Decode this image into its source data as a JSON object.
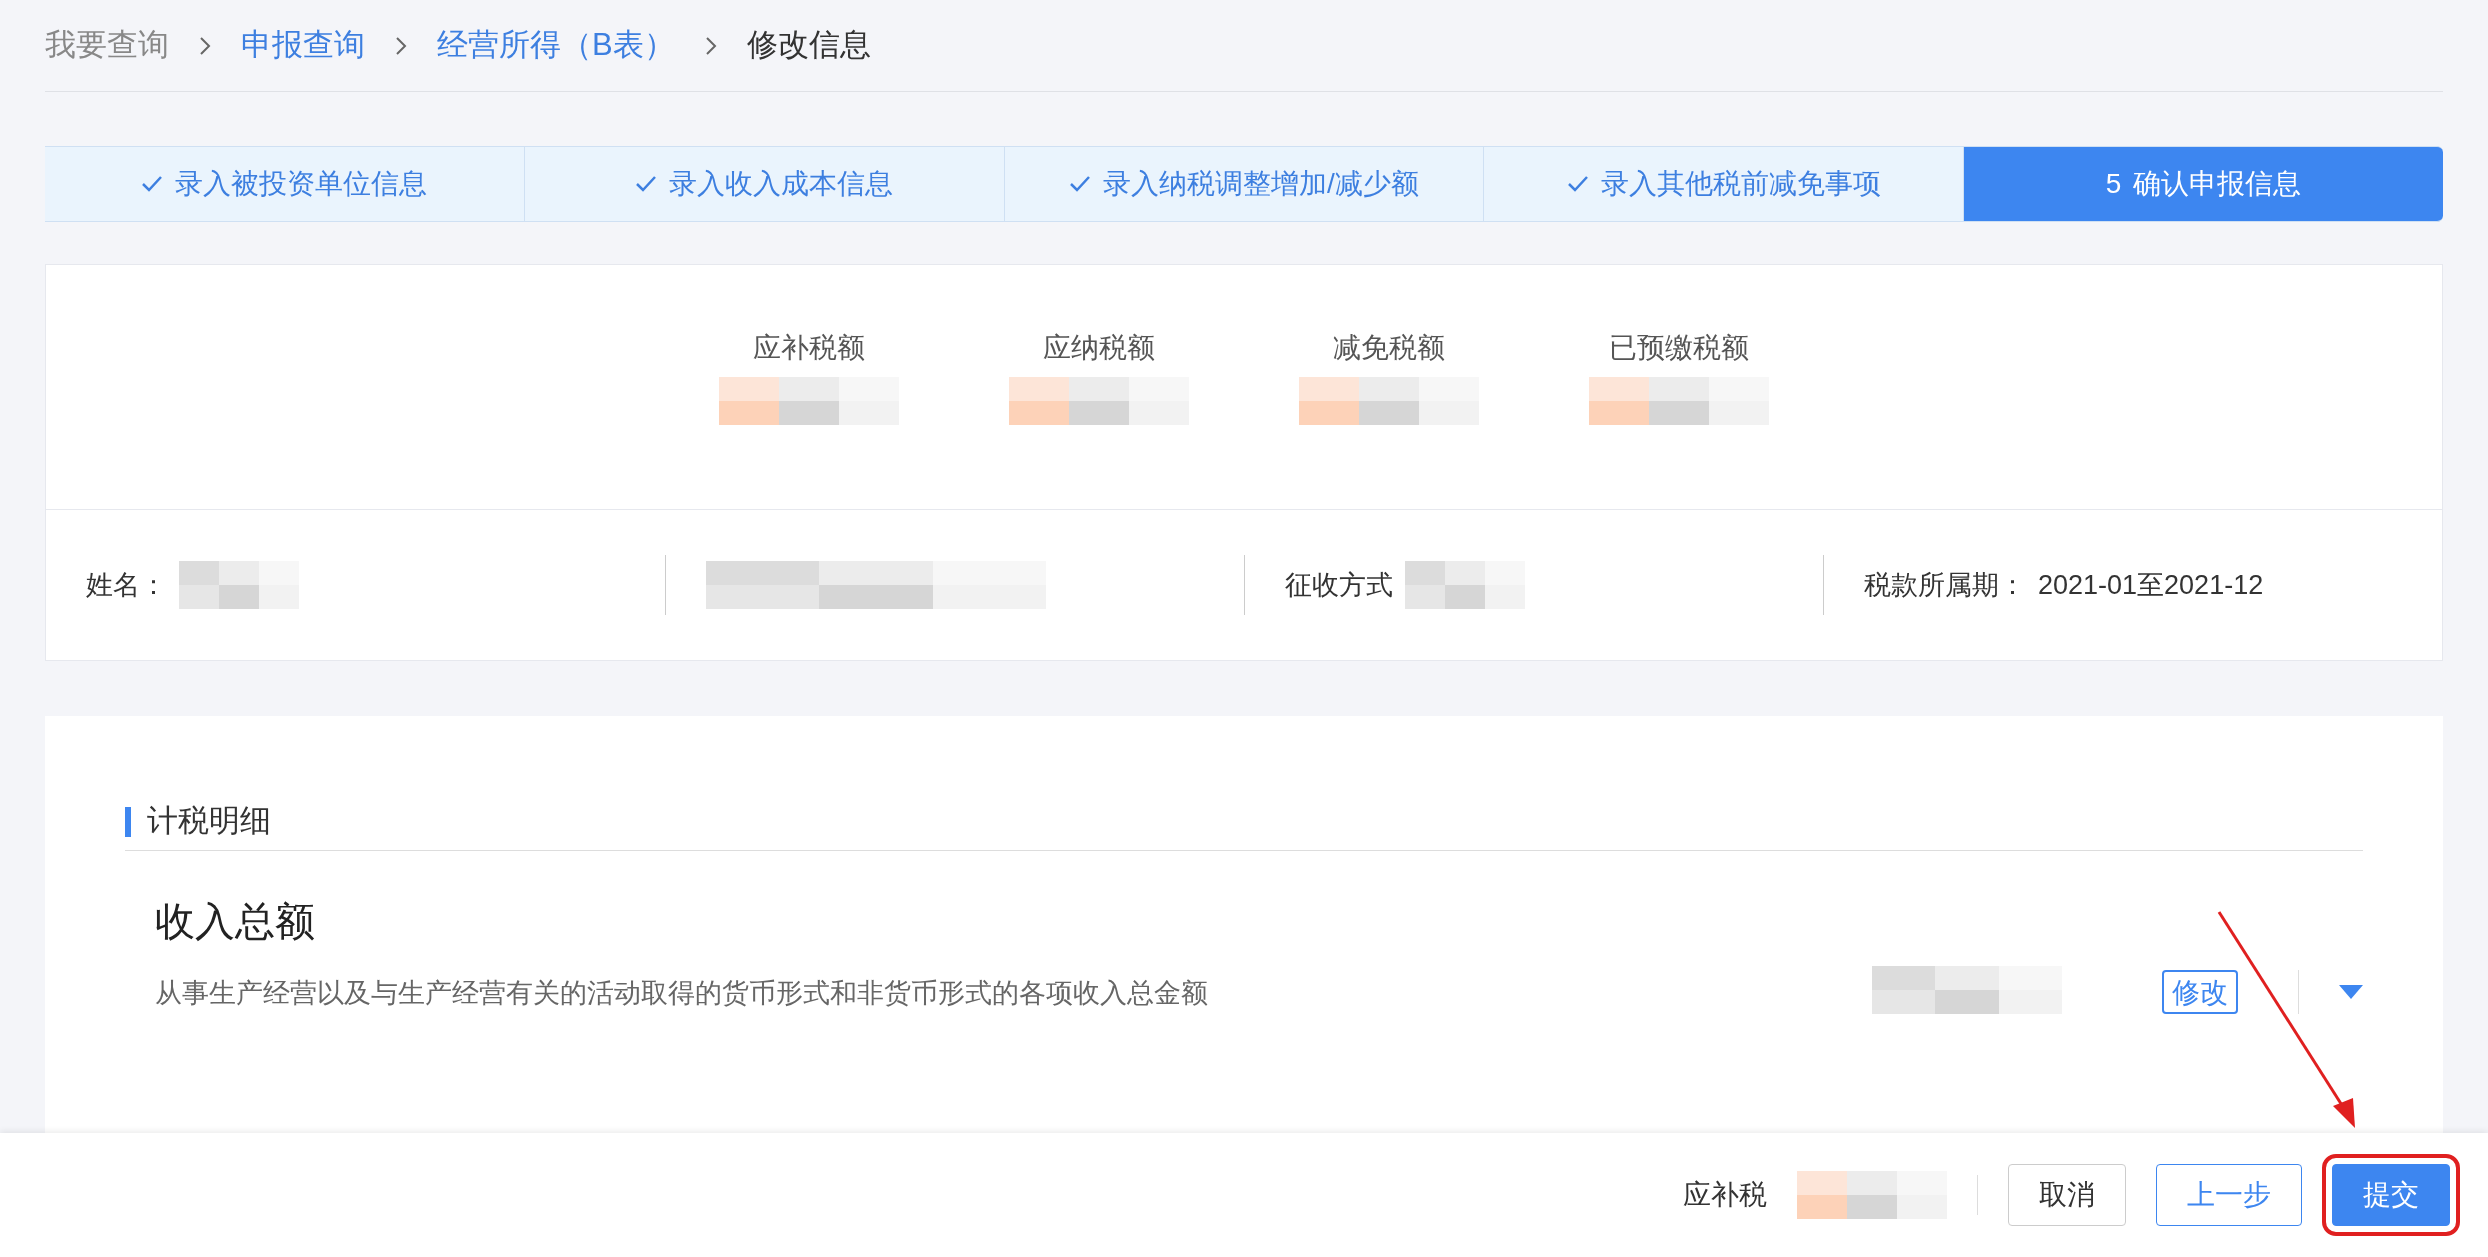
{
  "breadcrumb": [
    {
      "label": "我要查询",
      "kind": "plain"
    },
    {
      "label": "申报查询",
      "kind": "link"
    },
    {
      "label": "经营所得（B表）",
      "kind": "link"
    },
    {
      "label": "修改信息",
      "kind": "current"
    }
  ],
  "steps": [
    {
      "label": "录入被投资单位信息",
      "selected": false,
      "done": true
    },
    {
      "label": "录入收入成本信息",
      "selected": false,
      "done": true
    },
    {
      "label": "录入纳税调整增加/减少额",
      "selected": false,
      "done": true
    },
    {
      "label": "录入其他税前减免事项",
      "selected": false,
      "done": true
    },
    {
      "number": "5",
      "label": "确认申报信息",
      "selected": true,
      "done": false
    }
  ],
  "summary": [
    {
      "label": "应补税额"
    },
    {
      "label": "应纳税额"
    },
    {
      "label": "减免税额"
    },
    {
      "label": "已预缴税额"
    }
  ],
  "info": [
    {
      "kind": "field",
      "label": "姓名："
    },
    {
      "kind": "redacted"
    },
    {
      "kind": "field",
      "label": "征收方式"
    },
    {
      "kind": "field",
      "label": "税款所属期：",
      "value": "2021-01至2021-12"
    }
  ],
  "section_title": "计税明细",
  "item": {
    "title": "收入总额",
    "description": "从事生产经营以及与生产经营有关的活动取得的货币形式和非货币形式的各项收入总金额",
    "edit_button": "修改",
    "expanded": false
  },
  "footer": {
    "label": "应补税",
    "buttons": [
      {
        "label": "取消",
        "kind": "default"
      },
      {
        "label": "上一步",
        "kind": "outline"
      },
      {
        "label": "提交",
        "kind": "primary"
      }
    ]
  }
}
